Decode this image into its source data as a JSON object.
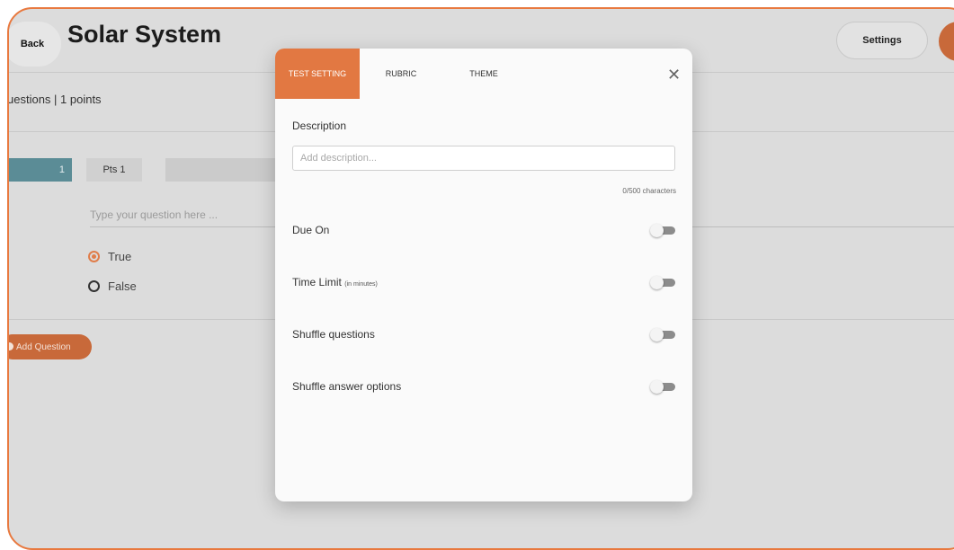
{
  "app": {
    "back_label": "Back",
    "title": "Solar System",
    "settings_label": "Settings",
    "summary": "uestions | 1 points"
  },
  "question": {
    "number": "1",
    "points": "Pts 1",
    "placeholder": "Type your question here ...",
    "options": [
      {
        "label": "True",
        "selected": true
      },
      {
        "label": "False",
        "selected": false
      }
    ],
    "add_label": "Add Question"
  },
  "modal": {
    "tabs": [
      {
        "label": "TEST SETTING",
        "active": true
      },
      {
        "label": "RUBRIC",
        "active": false
      },
      {
        "label": "THEME",
        "active": false
      }
    ],
    "close_glyph": "✕",
    "description": {
      "label": "Description",
      "placeholder": "Add description...",
      "value": "",
      "counter": "0/500 characters"
    },
    "settings": [
      {
        "label": "Due On",
        "note": "",
        "enabled": false
      },
      {
        "label": "Time Limit",
        "note": "(in minutes)",
        "enabled": false
      },
      {
        "label": "Shuffle questions",
        "note": "",
        "enabled": false
      },
      {
        "label": "Shuffle answer options",
        "note": "",
        "enabled": false
      }
    ]
  },
  "colors": {
    "accent": "#e27842",
    "accent_dim": "#c8693a",
    "question_tag": "#5b8c96"
  }
}
